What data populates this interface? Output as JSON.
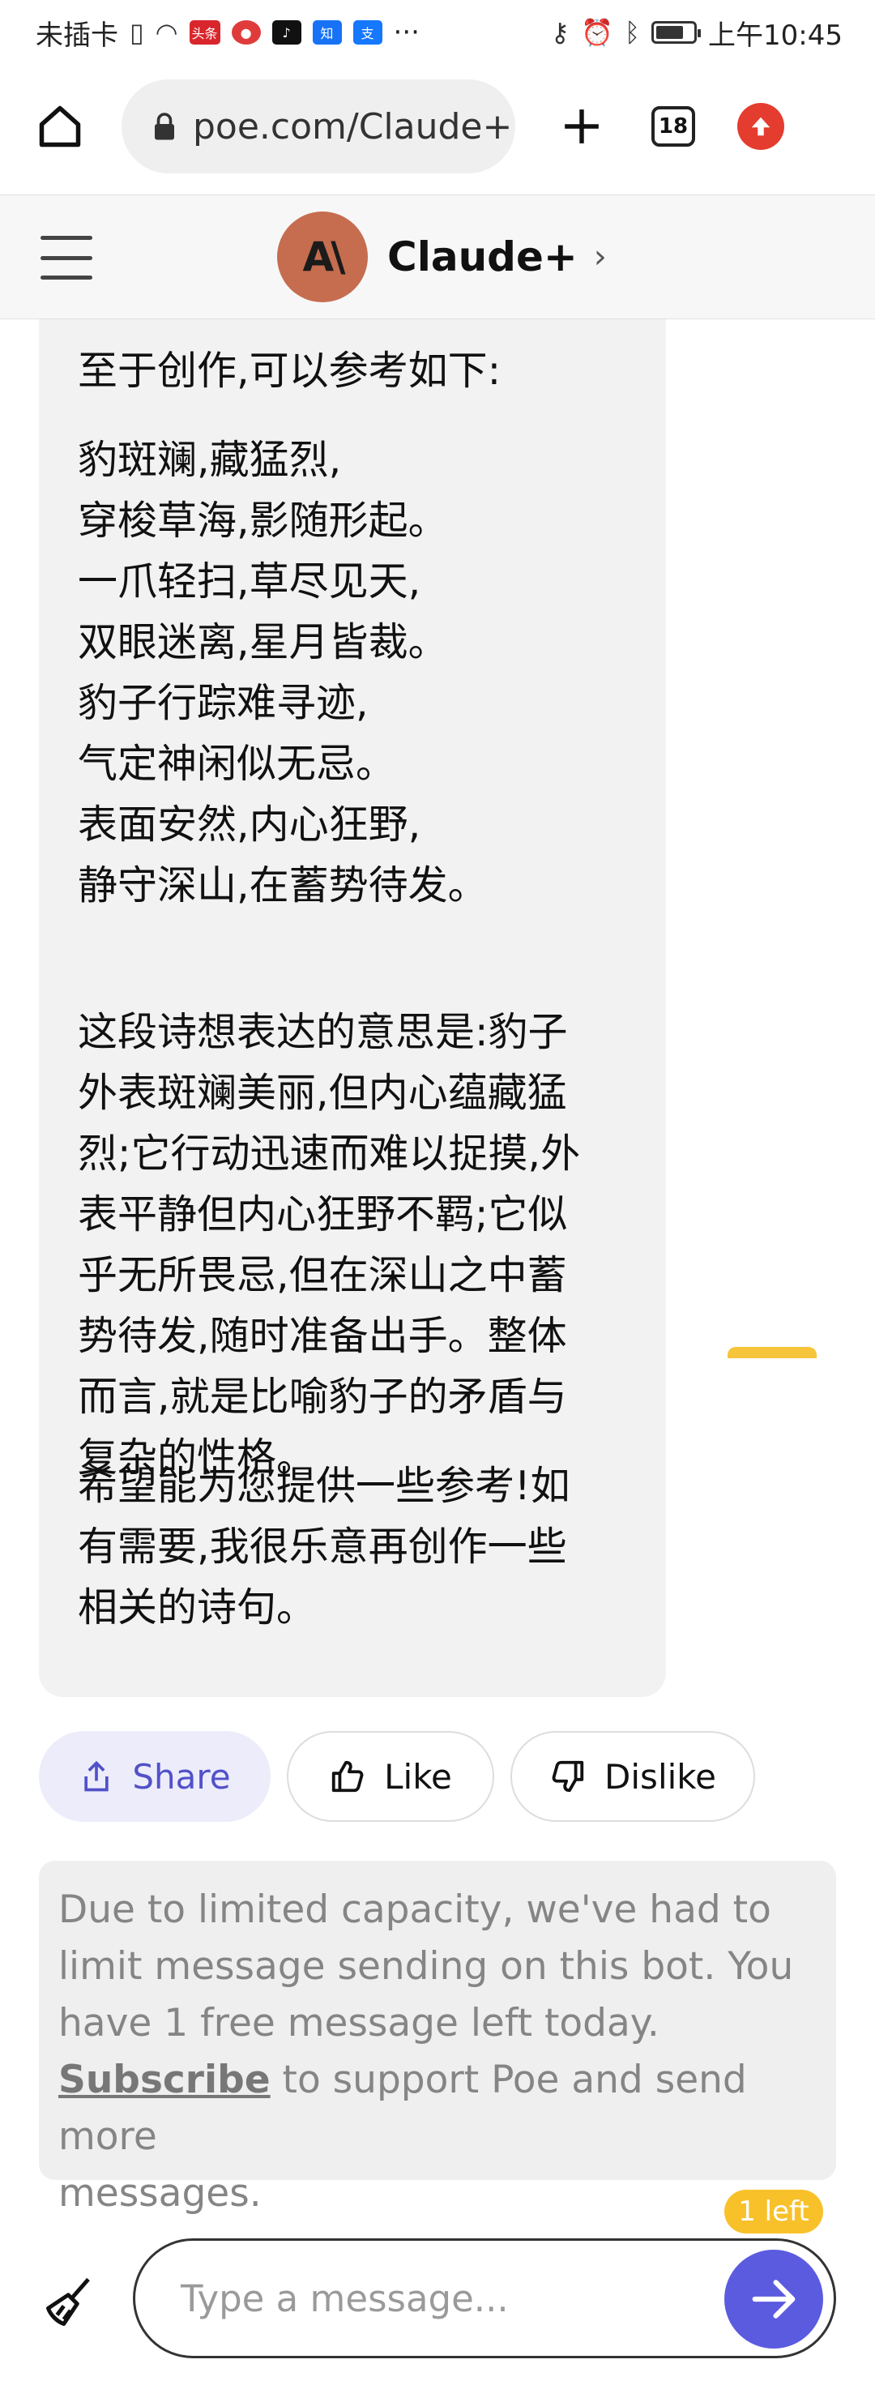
{
  "status_bar": {
    "carrier": "未插卡",
    "app_icons": [
      "头条",
      "知",
      "支"
    ],
    "overflow": "···",
    "time": "上午10:45",
    "battery_level": 0.75
  },
  "browser": {
    "url": "poe.com/Claude+",
    "tab_count": "18"
  },
  "header": {
    "avatar_text": "A\\",
    "bot_name": "Claude+"
  },
  "message": {
    "intro": "至于创作,可以参考如下:",
    "poem": [
      "豹斑斓,藏猛烈,",
      "穿梭草海,影随形起。",
      "一爪轻扫,草尽见天,",
      "双眼迷离,星月皆裁。",
      "豹子行踪难寻迹,",
      "气定神闲似无忌。",
      "表面安然,内心狂野,",
      "静守深山,在蓄势待发。"
    ],
    "explanation": [
      "这段诗想表达的意思是:豹子",
      "外表斑斓美丽,但内心蕴藏猛",
      "烈;它行动迅速而难以捉摸,外",
      "表平静但内心狂野不羁;它似",
      "乎无所畏忌,但在深山之中蓄",
      "势待发,随时准备出手。整体",
      "而言,就是比喻豹子的矛盾与",
      "复杂的性格。"
    ],
    "closing": [
      "希望能为您提供一些参考!如",
      "有需要,我很乐意再创作一些",
      "相关的诗句。"
    ]
  },
  "actions": {
    "share": "Share",
    "like": "Like",
    "dislike": "Dislike"
  },
  "notice": {
    "line1": "Due to limited capacity, we've had to",
    "line2": "limit message sending on this bot. You",
    "line3": "have 1 free message left today.",
    "subscribe_link": "Subscribe",
    "line4_rest": " to support Poe and send more",
    "line5": "messages."
  },
  "composer": {
    "remaining_badge": "1 left",
    "placeholder": "Type a message..."
  }
}
